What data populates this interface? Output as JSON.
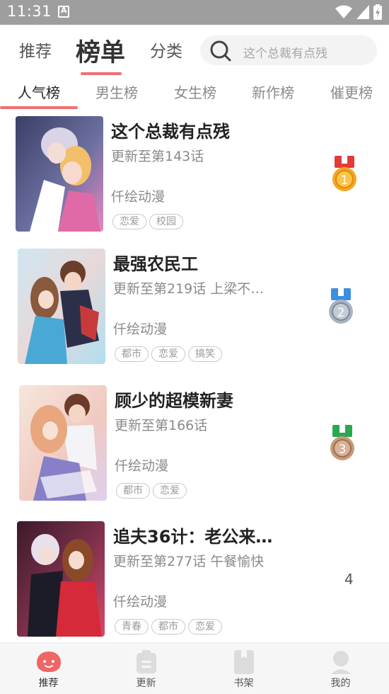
{
  "status_bar": {
    "time": "11:31",
    "notification_glyph": "A"
  },
  "header": {
    "tabs": [
      {
        "label": "推荐",
        "active": false
      },
      {
        "label": "榜单",
        "active": true
      },
      {
        "label": "分类",
        "active": false
      }
    ],
    "search": {
      "placeholder": "这个总裁有点残"
    }
  },
  "subtabs": [
    {
      "label": "人气榜",
      "active": true
    },
    {
      "label": "男生榜",
      "active": false
    },
    {
      "label": "女生榜",
      "active": false
    },
    {
      "label": "新作榜",
      "active": false
    },
    {
      "label": "催更榜",
      "active": false
    }
  ],
  "list": [
    {
      "title": "这个总裁有点残",
      "update": "更新至第143话",
      "author": "仟绘动漫",
      "tags": [
        "恋爱",
        "校园"
      ],
      "rank": "1",
      "medal_color": "gold"
    },
    {
      "title": "最强农民工",
      "update": "更新至第219话 上梁不…",
      "author": "仟绘动漫",
      "tags": [
        "都市",
        "恋爱",
        "搞笑"
      ],
      "rank": "2",
      "medal_color": "silver"
    },
    {
      "title": "顾少的超模新妻",
      "update": "更新至第166话",
      "author": "仟绘动漫",
      "tags": [
        "都市",
        "恋爱"
      ],
      "rank": "3",
      "medal_color": "bronze"
    },
    {
      "title": "追夫36计：老公来…",
      "update": "更新至第277话 午餐愉快",
      "author": "仟绘动漫",
      "tags": [
        "青春",
        "都市",
        "恋爱"
      ],
      "rank": "4",
      "medal_color": ""
    }
  ],
  "bottom_nav": [
    {
      "label": "推荐",
      "icon": "smile-blob-icon",
      "active": true
    },
    {
      "label": "更新",
      "icon": "clipboard-icon",
      "active": false
    },
    {
      "label": "书架",
      "icon": "book-icon",
      "active": false
    },
    {
      "label": "我的",
      "icon": "person-icon",
      "active": false
    }
  ],
  "colors": {
    "accent": "#f07070",
    "status_bar": "#9e9e9e",
    "gold": "#f5a623",
    "silver": "#a9b4c2",
    "bronze": "#c79a7c"
  }
}
